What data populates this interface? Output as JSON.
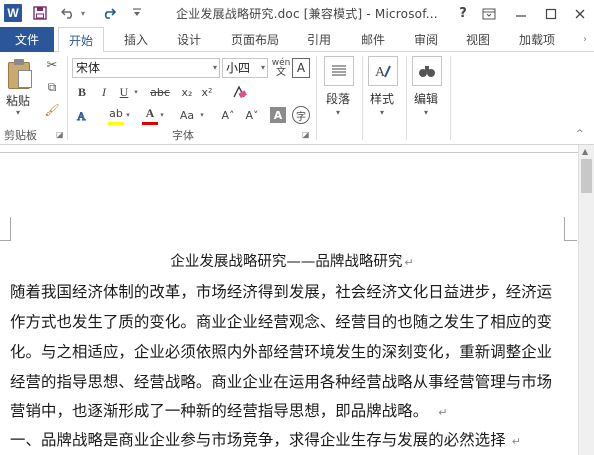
{
  "titlebar": {
    "app_icon_letter": "W",
    "title": "企业发展战略研究.doc [兼容模式] - Microsof...",
    "help": "?"
  },
  "tabs": {
    "file": "文件",
    "items": [
      "开始",
      "插入",
      "设计",
      "页面布局",
      "引用",
      "邮件",
      "审阅",
      "视图",
      "加载项"
    ]
  },
  "ribbon": {
    "clipboard": {
      "paste_label": "粘贴",
      "group_label": "剪贴板"
    },
    "font": {
      "font_name": "宋体",
      "font_size": "小四",
      "wen_top": "wén",
      "wen_bottom": "文",
      "char_border": "A",
      "bold": "B",
      "italic": "I",
      "underline": "U",
      "strike": "abc",
      "subscript": "x₂",
      "superscript": "x²",
      "highlight": "ab",
      "font_color": "A",
      "change_case": "Aa",
      "grow": "A˄",
      "shrink": "A˅",
      "shade": "A",
      "enclose": "字",
      "group_label": "字体"
    },
    "paragraph_label": "段落",
    "styles_label": "样式",
    "editing_label": "编辑"
  },
  "document": {
    "title": "企业发展战略研究——品牌战略研究",
    "lines": [
      "随着我国经济体制的改革，市场经济得到发展，社会经济文化日益进步，经济运",
      "作方式也发生了质的变化。商业企业经营观念、经营目的也随之发生了相应的变",
      "化。与之相适应，企业必须依照内外部经营环境发生的深刻变化，重新调整企业",
      "经营的指导思想、经营战略。商业企业在运用各种经营战略从事经营管理与市场",
      "营销中，也逐渐形成了一种新的经营指导思想，即品牌战略。",
      "一、品牌战略是商业企业参与市场竞争，求得企业生存与发展的必然选择"
    ],
    "paragraph_mark": "↵"
  },
  "colors": {
    "accent": "#2b579a",
    "highlight": "#ffff00",
    "font_color": "#e00000"
  }
}
